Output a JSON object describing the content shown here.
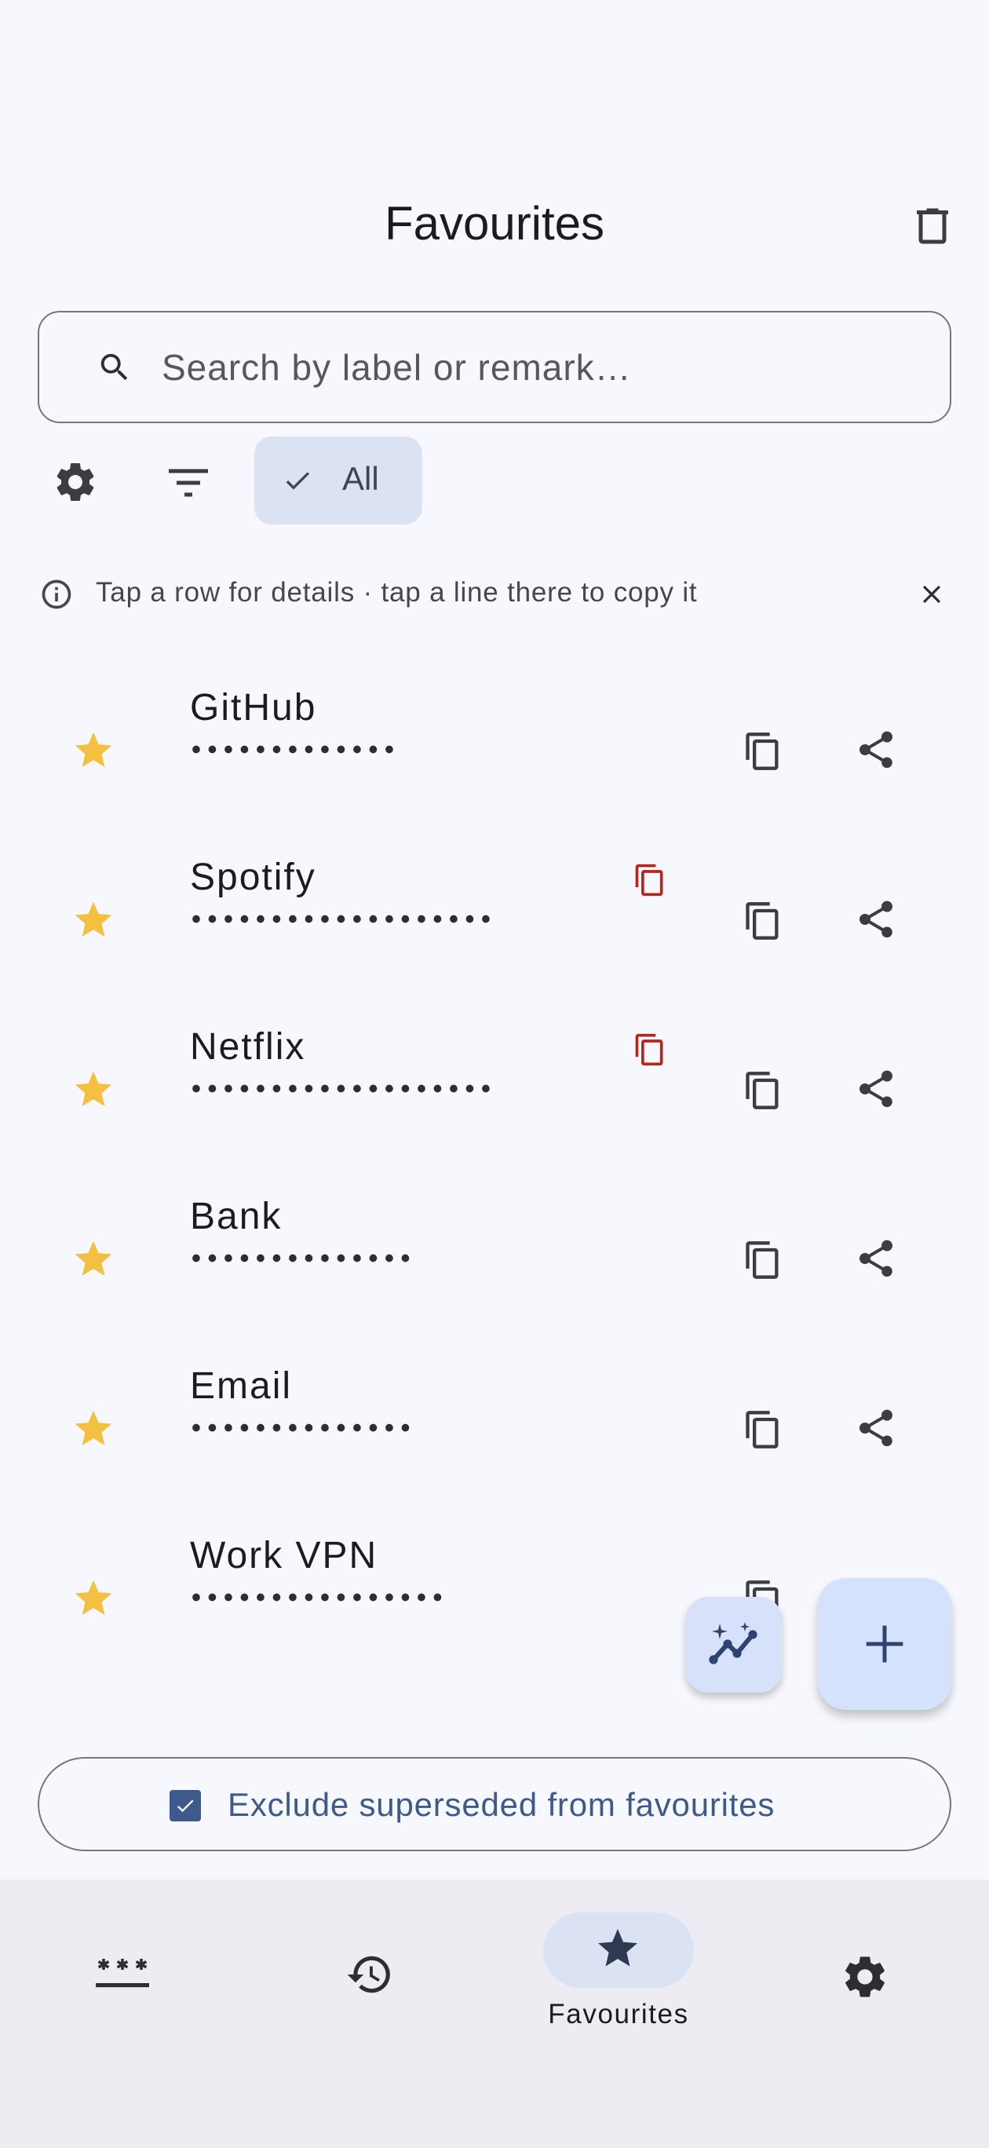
{
  "header": {
    "title": "Favourites"
  },
  "search": {
    "placeholder": "Search by label or remark…"
  },
  "filter": {
    "chip_label": "All"
  },
  "info": {
    "text": "Tap a row for details · tap a line there to copy it"
  },
  "colors": {
    "accent": "#3e5a8c",
    "star": "#f4c041",
    "warning": "#b3261e",
    "chip_bg": "#dbe2f4",
    "fab_bg": "#d5e2fb"
  },
  "entries": [
    {
      "label": "GitHub",
      "masked": "•••••••••••••",
      "starred": true,
      "warning": false
    },
    {
      "label": "Spotify",
      "masked": "•••••••••••••••••••",
      "starred": true,
      "warning": true
    },
    {
      "label": "Netflix",
      "masked": "•••••••••••••••••••",
      "starred": true,
      "warning": true
    },
    {
      "label": "Bank",
      "masked": "••••••••••••••",
      "starred": true,
      "warning": false
    },
    {
      "label": "Email",
      "masked": "••••••••••••••",
      "starred": true,
      "warning": false
    },
    {
      "label": "Work VPN",
      "masked": "••••••••••••••••",
      "starred": true,
      "warning": false
    }
  ],
  "exclude": {
    "label": "Exclude superseded from favourites",
    "checked": true
  },
  "nav": {
    "items": [
      {
        "icon": "password-icon",
        "label": ""
      },
      {
        "icon": "history-icon",
        "label": ""
      },
      {
        "icon": "star-icon",
        "label": "Favourites",
        "active": true
      },
      {
        "icon": "settings-icon",
        "label": ""
      }
    ]
  }
}
